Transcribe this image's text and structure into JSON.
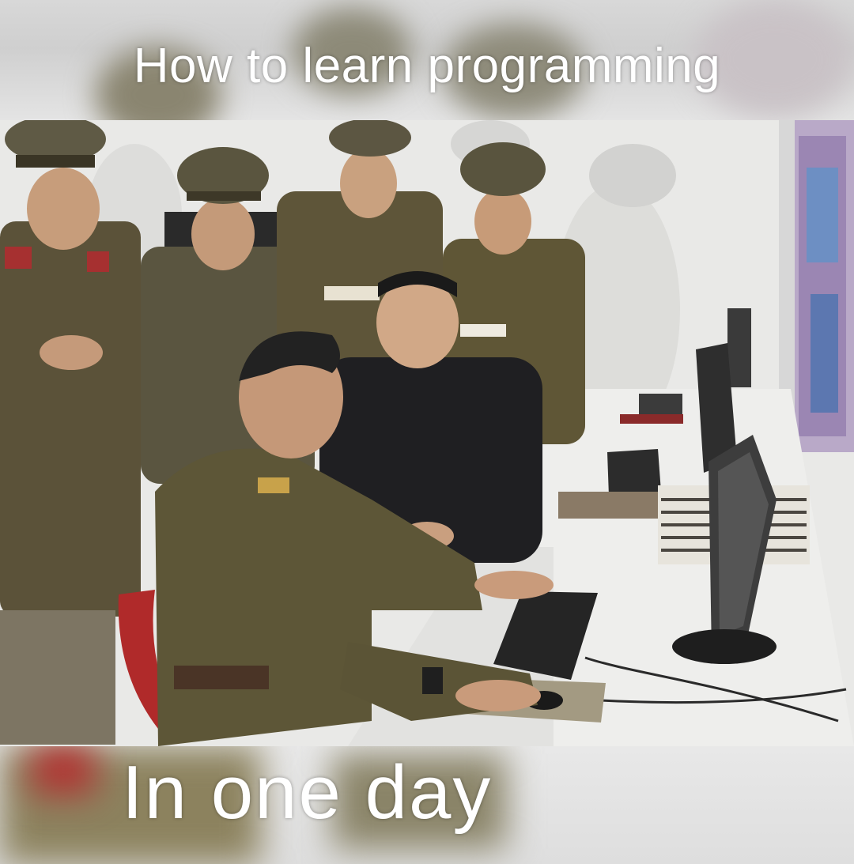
{
  "meme": {
    "top_text": "How to learn programming",
    "bottom_text": "In one day"
  }
}
